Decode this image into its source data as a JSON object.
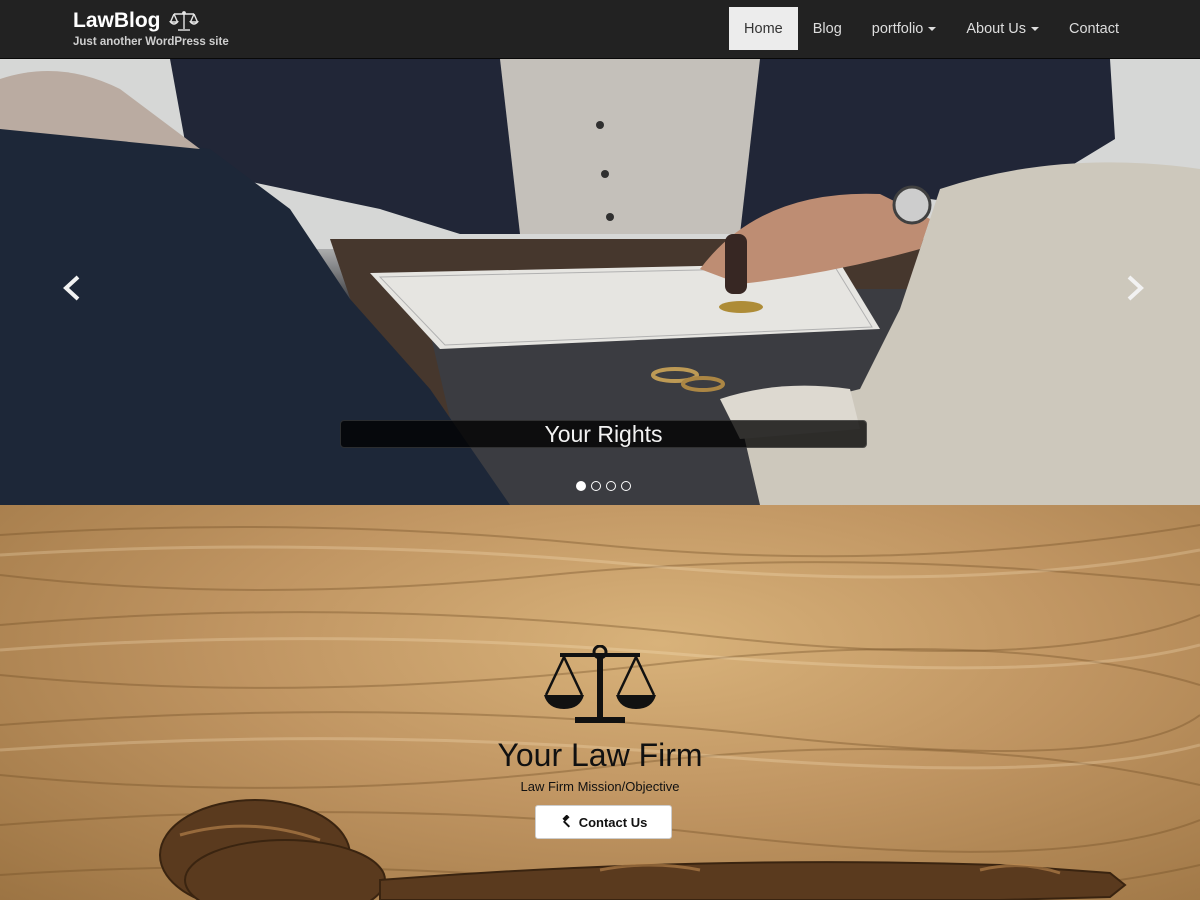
{
  "brand": {
    "name": "LawBlog",
    "tagline": "Just another WordPress site",
    "icon": "scale-icon"
  },
  "nav": {
    "items": [
      {
        "label": "Home",
        "active": true,
        "dropdown": false
      },
      {
        "label": "Blog",
        "active": false,
        "dropdown": false
      },
      {
        "label": "portfolio",
        "active": false,
        "dropdown": true
      },
      {
        "label": "About Us",
        "active": false,
        "dropdown": true
      },
      {
        "label": "Contact",
        "active": false,
        "dropdown": false
      }
    ]
  },
  "slider": {
    "caption": "Your Rights",
    "slide_count": 4,
    "active_index": 0,
    "prev_icon": "chevron-left-icon",
    "next_icon": "chevron-right-icon"
  },
  "firm": {
    "title": "Your Law Firm",
    "subtitle": "Law Firm Mission/Objective",
    "button_label": "Contact Us",
    "button_icon": "gavel-icon",
    "logo_icon": "scale-icon"
  },
  "colors": {
    "navbar": "#222222",
    "nav_active_bg": "#ececec",
    "caption_bg": "#000000"
  }
}
